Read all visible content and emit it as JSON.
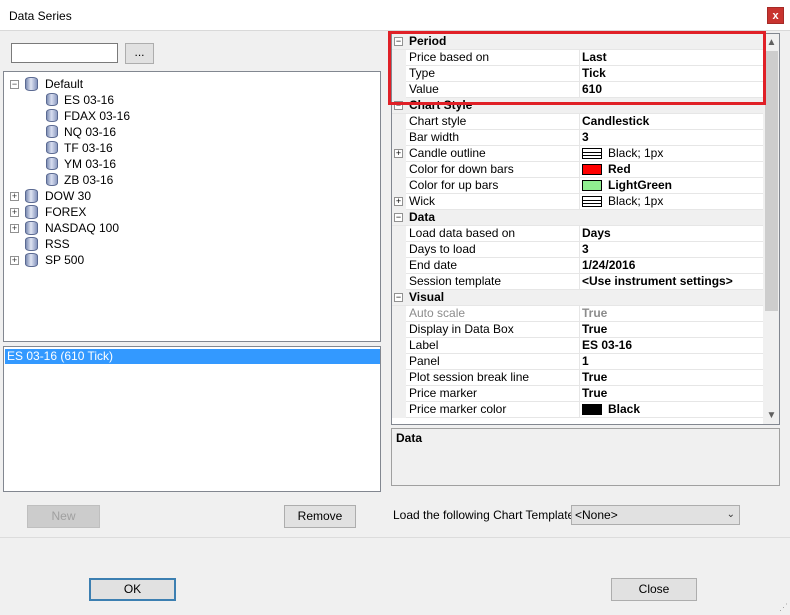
{
  "window": {
    "title": "Data Series",
    "close_glyph": "x"
  },
  "search": {
    "value": "",
    "browse_label": "..."
  },
  "tree": {
    "default": {
      "label": "Default",
      "children": [
        "ES 03-16",
        "FDAX 03-16",
        "NQ 03-16",
        "TF 03-16",
        "YM 03-16",
        "ZB 03-16"
      ]
    },
    "collapsed": [
      "DOW 30",
      "FOREX",
      "NASDAQ 100"
    ],
    "rss": "RSS",
    "sp500": "SP 500"
  },
  "series_list": {
    "selected": "ES 03-16 (610 Tick)"
  },
  "buttons": {
    "new": "New",
    "remove": "Remove",
    "ok": "OK",
    "close": "Close"
  },
  "properties": {
    "period": {
      "title": "Period",
      "price_based_on": {
        "name": "Price based on",
        "value": "Last"
      },
      "type": {
        "name": "Type",
        "value": "Tick"
      },
      "value": {
        "name": "Value",
        "value": "610"
      }
    },
    "chart_style": {
      "title": "Chart Style",
      "chart_style": {
        "name": "Chart style",
        "value": "Candlestick"
      },
      "bar_width": {
        "name": "Bar width",
        "value": "3"
      },
      "candle_outline": {
        "name": "Candle outline",
        "value": "Black; 1px"
      },
      "color_down": {
        "name": "Color for down bars",
        "value": "Red",
        "color": "#ff0000"
      },
      "color_up": {
        "name": "Color for up bars",
        "value": "LightGreen",
        "color": "#90ee90"
      },
      "wick": {
        "name": "Wick",
        "value": "Black; 1px"
      }
    },
    "data": {
      "title": "Data",
      "load_based_on": {
        "name": "Load data based on",
        "value": "Days"
      },
      "days_to_load": {
        "name": "Days to load",
        "value": "3"
      },
      "end_date": {
        "name": "End date",
        "value": "1/24/2016"
      },
      "session_template": {
        "name": "Session template",
        "value": "<Use instrument settings>"
      }
    },
    "visual": {
      "title": "Visual",
      "auto_scale": {
        "name": "Auto scale",
        "value": "True"
      },
      "display_data_box": {
        "name": "Display in Data Box",
        "value": "True"
      },
      "label": {
        "name": "Label",
        "value": "ES 03-16"
      },
      "panel": {
        "name": "Panel",
        "value": "1"
      },
      "plot_session_break": {
        "name": "Plot session break line",
        "value": "True"
      },
      "price_marker": {
        "name": "Price marker",
        "value": "True"
      },
      "price_marker_color": {
        "name": "Price marker color",
        "value": "Black",
        "color": "#000000"
      }
    }
  },
  "description": {
    "title": "Data"
  },
  "template": {
    "label": "Load the following Chart Template:",
    "selected": "<None>"
  },
  "colors": {
    "highlight": "#e02027",
    "selection": "#3399ff"
  }
}
